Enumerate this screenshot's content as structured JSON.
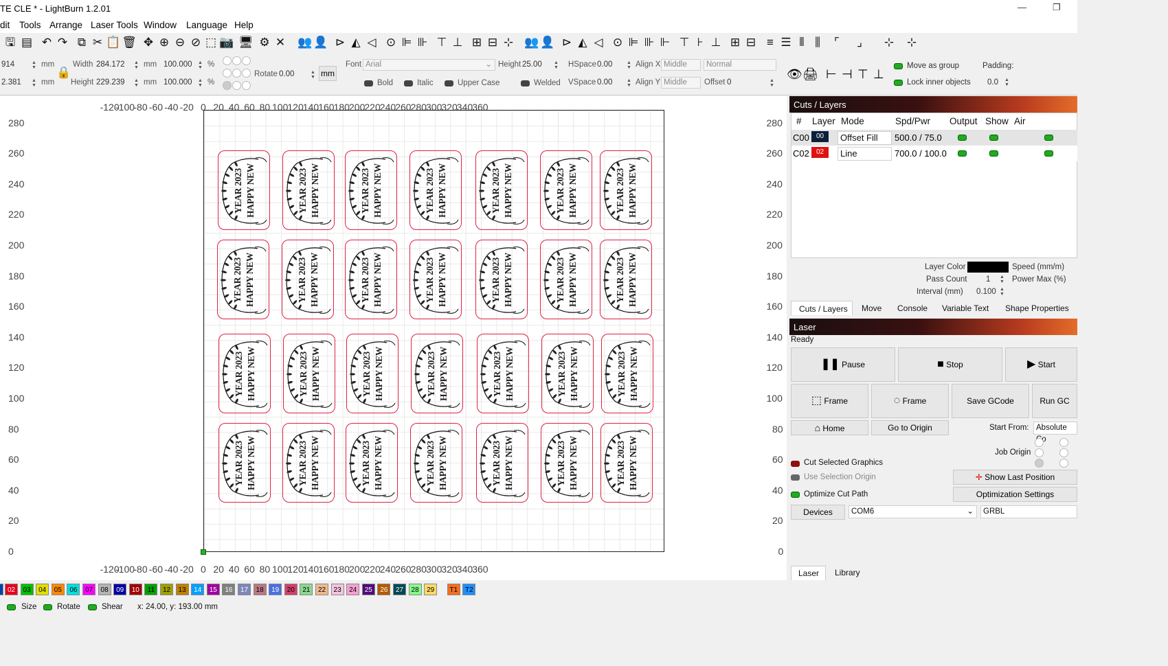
{
  "window": {
    "title": "TE CLE * - LightBurn 1.2.01",
    "minimize": "—",
    "restore": "❐"
  },
  "menu": [
    "dit",
    "Tools",
    "Arrange",
    "Laser Tools",
    "Window",
    "Language",
    "Help"
  ],
  "props": {
    "x_value": "914",
    "y_value": "2.381",
    "unit_mm": "mm",
    "width_label": "Width",
    "width_value": "284.172",
    "height_label": "Height",
    "height_value": "229.239",
    "scale_w": "100.000",
    "scale_h": "100.000",
    "pct": "%",
    "rotate_label": "Rotate",
    "rotate_value": "0.00",
    "mm_button": "mm",
    "font_label": "Font",
    "font_value": "Arial",
    "text_height_label": "Height",
    "text_height_value": "25.00",
    "hspace_label": "HSpace",
    "hspace_value": "0.00",
    "vspace_label": "VSpace",
    "vspace_value": "0.00",
    "alignx_label": "Align X",
    "alignx_value": "Middle",
    "aligny_label": "Align Y",
    "aligny_value": "Middle",
    "normal_value": "Normal",
    "offset_label": "Offset",
    "offset_value": "0",
    "bold": "Bold",
    "italic": "Italic",
    "upper_case": "Upper Case",
    "welded": "Welded",
    "move_as_group": "Move as group",
    "lock_inner": "Lock inner objects",
    "padding_label": "Padding:",
    "padding_value": "0.0"
  },
  "ruler": {
    "x": [
      "-120",
      "-100",
      "-80",
      "-60",
      "-40",
      "-20",
      "0",
      "20",
      "40",
      "60",
      "80",
      "100",
      "120",
      "140",
      "160",
      "180",
      "200",
      "220",
      "240",
      "260",
      "280",
      "300",
      "320",
      "340",
      "360"
    ],
    "y": [
      "280",
      "260",
      "240",
      "220",
      "200",
      "180",
      "160",
      "140",
      "120",
      "100",
      "80",
      "60",
      "40",
      "20",
      "0"
    ]
  },
  "tag": {
    "line1": "HAPPY NEW",
    "line2": "YEAR 2023"
  },
  "cuts": {
    "title": "Cuts / Layers",
    "headers": [
      "#",
      "Layer",
      "Mode",
      "Spd/Pwr",
      "Output",
      "Show",
      "Air"
    ],
    "rows": [
      {
        "id": "C00",
        "layer": "00",
        "color": "#0a1f3a",
        "mode": "Offset Fill",
        "spdpwr": "500.0 / 75.0"
      },
      {
        "id": "C02",
        "layer": "02",
        "color": "#e01010",
        "mode": "Line",
        "spdpwr": "700.0 / 100.0"
      }
    ],
    "layer_color": "Layer Color",
    "pass_count": "Pass Count",
    "pass_count_value": "1",
    "interval": "Interval (mm)",
    "interval_value": "0.100",
    "speed": "Speed (mm/m)",
    "power_max": "Power Max (%)"
  },
  "tabs1": [
    "Cuts / Layers",
    "Move",
    "Console",
    "Variable Text",
    "Shape Properties"
  ],
  "laser": {
    "title": "Laser",
    "status": "Ready",
    "pause": "Pause",
    "stop": "Stop",
    "start": "Start",
    "frame1": "Frame",
    "frame2": "Frame",
    "save_gcode": "Save GCode",
    "run_gcode": "Run GC",
    "home": "Home",
    "go_origin": "Go to Origin",
    "start_from": "Start From:",
    "start_from_value": "Absolute Co",
    "job_origin": "Job Origin",
    "cut_selected": "Cut Selected Graphics",
    "use_selection_origin": "Use Selection Origin",
    "optimize": "Optimize Cut Path",
    "show_last": "Show Last Position",
    "opt_settings": "Optimization Settings",
    "devices": "Devices",
    "port": "COM6",
    "controller": "GRBL"
  },
  "tabs2": [
    "Laser",
    "Library"
  ],
  "palette": [
    {
      "n": "02",
      "c": "#e8001c"
    },
    {
      "n": "03",
      "c": "#00c000"
    },
    {
      "n": "04",
      "c": "#e0e000"
    },
    {
      "n": "05",
      "c": "#ff8800"
    },
    {
      "n": "06",
      "c": "#00e0e0"
    },
    {
      "n": "07",
      "c": "#ff00ff"
    },
    {
      "n": "08",
      "c": "#b4b4b4"
    },
    {
      "n": "09",
      "c": "#0000a0"
    },
    {
      "n": "10",
      "c": "#a00000"
    },
    {
      "n": "11",
      "c": "#00a000"
    },
    {
      "n": "12",
      "c": "#a0a000"
    },
    {
      "n": "13",
      "c": "#c08000"
    },
    {
      "n": "14",
      "c": "#00a0ff"
    },
    {
      "n": "15",
      "c": "#a000a0"
    },
    {
      "n": "16",
      "c": "#808080"
    },
    {
      "n": "17",
      "c": "#7d87b9"
    },
    {
      "n": "18",
      "c": "#bb7784"
    },
    {
      "n": "19",
      "c": "#4a6fe3"
    },
    {
      "n": "20",
      "c": "#d33f6a"
    },
    {
      "n": "21",
      "c": "#8cd78f"
    },
    {
      "n": "22",
      "c": "#f0b98d"
    },
    {
      "n": "23",
      "c": "#f6c4e1"
    },
    {
      "n": "24",
      "c": "#fa9ed4"
    },
    {
      "n": "25",
      "c": "#500a78"
    },
    {
      "n": "26",
      "c": "#b45a00"
    },
    {
      "n": "27",
      "c": "#004754"
    },
    {
      "n": "28",
      "c": "#86fa88"
    },
    {
      "n": "29",
      "c": "#ffdb66"
    },
    {
      "n": "T1",
      "c": "#f37021"
    },
    {
      "n": "T2",
      "c": "#1e90ff"
    }
  ],
  "status": {
    "size": "Size",
    "rotate": "Rotate",
    "shear": "Shear",
    "coords": "x: 24.00, y: 193.00 mm"
  }
}
